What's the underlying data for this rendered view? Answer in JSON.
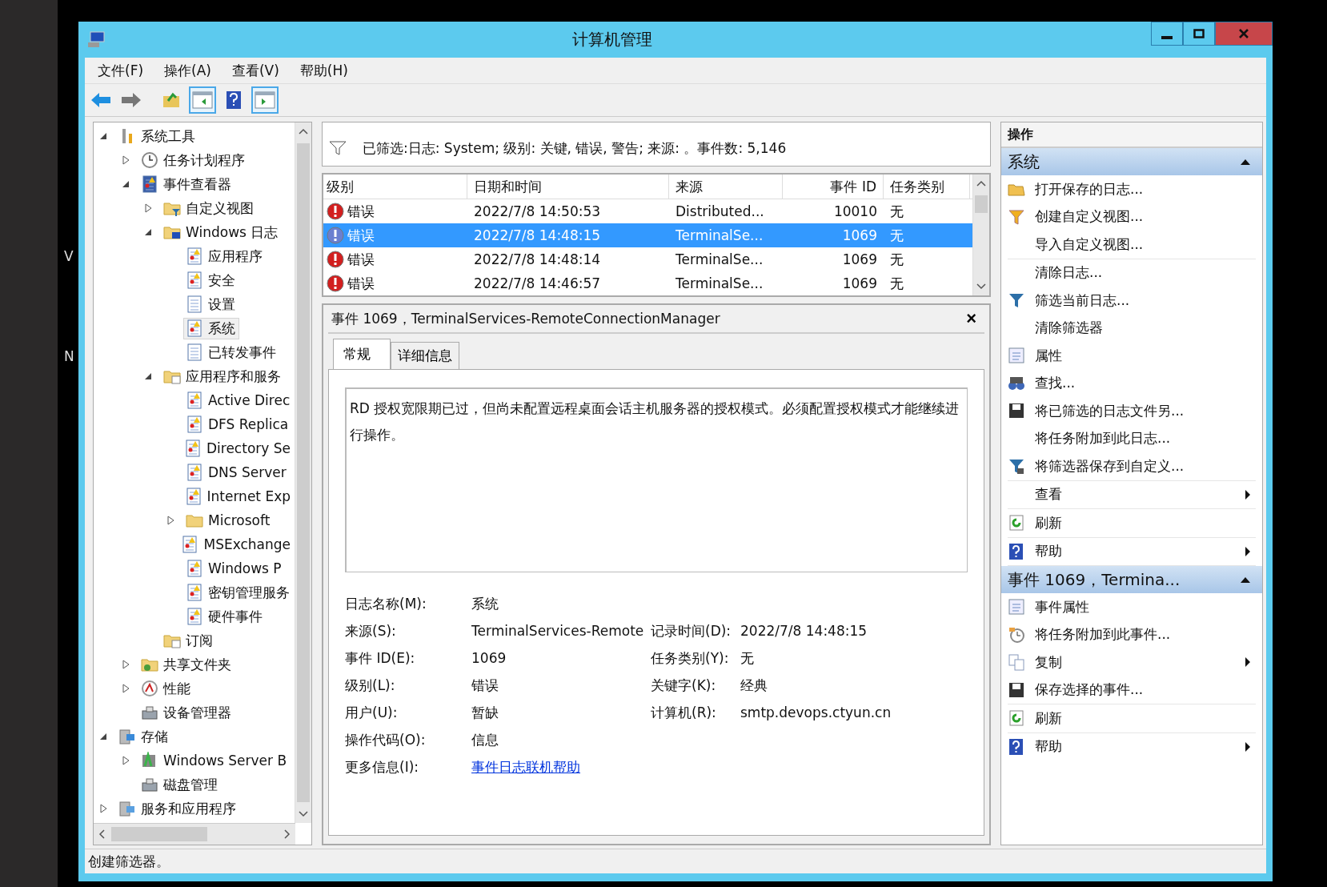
{
  "desktop_fragments": [
    "V",
    "N"
  ],
  "window": {
    "title": "计算机管理"
  },
  "menu": [
    "文件(F)",
    "操作(A)",
    "查看(V)",
    "帮助(H)"
  ],
  "toolbar": [
    {
      "kind": "back",
      "pressed": false
    },
    {
      "kind": "forward",
      "pressed": false
    },
    {
      "kind": "up",
      "pressed": false
    },
    {
      "kind": "tree-toggle",
      "pressed": true
    },
    {
      "kind": "help",
      "pressed": false
    },
    {
      "kind": "action-toggle",
      "pressed": true
    }
  ],
  "tree": {
    "items": [
      {
        "label": "系统工具",
        "kind": "tool",
        "expanded": true,
        "selected": false,
        "children": [
          {
            "label": "任务计划程序",
            "kind": "clock",
            "expanded": false,
            "selected": false
          },
          {
            "label": "事件查看器",
            "kind": "viewer",
            "expanded": true,
            "selected": false,
            "children": [
              {
                "label": "自定义视图",
                "kind": "folder-filter",
                "expanded": false,
                "selected": false
              },
              {
                "label": "Windows 日志",
                "kind": "folder-pc",
                "expanded": true,
                "selected": false,
                "children": [
                  {
                    "label": "应用程序",
                    "kind": "log",
                    "selected": false
                  },
                  {
                    "label": "安全",
                    "kind": "log",
                    "selected": false
                  },
                  {
                    "label": "设置",
                    "kind": "log-plain",
                    "selected": false
                  },
                  {
                    "label": "系统",
                    "kind": "log",
                    "selected": true
                  },
                  {
                    "label": "已转发事件",
                    "kind": "log-plain",
                    "selected": false
                  }
                ]
              },
              {
                "label": "应用程序和服务",
                "kind": "folder-page",
                "expanded": true,
                "selected": false,
                "children": [
                  {
                    "label": "Active Direc",
                    "kind": "log",
                    "selected": false
                  },
                  {
                    "label": "DFS Replica",
                    "kind": "log",
                    "selected": false
                  },
                  {
                    "label": "Directory Se",
                    "kind": "log",
                    "selected": false
                  },
                  {
                    "label": "DNS Server",
                    "kind": "log",
                    "selected": false
                  },
                  {
                    "label": "Internet Exp",
                    "kind": "log",
                    "selected": false
                  },
                  {
                    "label": "Microsoft",
                    "kind": "folder",
                    "expanded": false,
                    "selected": false
                  },
                  {
                    "label": "MSExchange",
                    "kind": "log",
                    "selected": false
                  },
                  {
                    "label": "Windows P",
                    "kind": "log",
                    "selected": false
                  },
                  {
                    "label": "密钥管理服务",
                    "kind": "log",
                    "selected": false
                  },
                  {
                    "label": "硬件事件",
                    "kind": "log",
                    "selected": false
                  }
                ]
              },
              {
                "label": "订阅",
                "kind": "folder-sub",
                "selected": false
              }
            ]
          },
          {
            "label": "共享文件夹",
            "kind": "share",
            "expanded": false,
            "selected": false
          },
          {
            "label": "性能",
            "kind": "perf",
            "expanded": false,
            "selected": false
          },
          {
            "label": "设备管理器",
            "kind": "device",
            "selected": false
          }
        ]
      },
      {
        "label": "存储",
        "kind": "storage",
        "expanded": true,
        "selected": false,
        "children": [
          {
            "label": "Windows Server B",
            "kind": "backup",
            "expanded": false,
            "selected": false
          },
          {
            "label": "磁盘管理",
            "kind": "disk",
            "selected": false
          }
        ]
      },
      {
        "label": "服务和应用程序",
        "kind": "services",
        "expanded": false,
        "selected": false
      }
    ]
  },
  "filter_bar": {
    "text": "已筛选:日志: System; 级别: 关键, 错误, 警告; 来源: 。事件数: 5,146"
  },
  "events": {
    "columns": [
      "级别",
      "日期和时间",
      "来源",
      "事件 ID",
      "任务类别"
    ],
    "rows": [
      {
        "level": "错误",
        "datetime": "2022/7/8 14:50:53",
        "source": "Distributed...",
        "event_id": "10010",
        "task_category": "无",
        "selected": false
      },
      {
        "level": "错误",
        "datetime": "2022/7/8 14:48:15",
        "source": "TerminalSe...",
        "event_id": "1069",
        "task_category": "无",
        "selected": true
      },
      {
        "level": "错误",
        "datetime": "2022/7/8 14:48:14",
        "source": "TerminalSe...",
        "event_id": "1069",
        "task_category": "无",
        "selected": false
      },
      {
        "level": "错误",
        "datetime": "2022/7/8 14:46:57",
        "source": "TerminalSe...",
        "event_id": "1069",
        "task_category": "无",
        "selected": false
      }
    ]
  },
  "detail": {
    "title": "事件 1069，TerminalServices-RemoteConnectionManager",
    "close": "×",
    "tabs": [
      {
        "label": "常规",
        "selected": true
      },
      {
        "label": "详细信息",
        "selected": false
      }
    ],
    "description": "RD 授权宽限期已过，但尚未配置远程桌面会话主机服务器的授权模式。必须配置授权模式才能继续进行操作。",
    "fields": [
      [
        {
          "label": "日志名称(M):",
          "value": "系统",
          "kind": "text"
        }
      ],
      [
        {
          "label": "来源(S):",
          "value": "TerminalServices-Remote",
          "kind": "text"
        },
        {
          "label": "记录时间(D):",
          "value": "2022/7/8 14:48:15",
          "kind": "text"
        }
      ],
      [
        {
          "label": "事件 ID(E):",
          "value": "1069",
          "kind": "text"
        },
        {
          "label": "任务类别(Y):",
          "value": "无",
          "kind": "text"
        }
      ],
      [
        {
          "label": "级别(L):",
          "value": "错误",
          "kind": "text"
        },
        {
          "label": "关键字(K):",
          "value": "经典",
          "kind": "text"
        }
      ],
      [
        {
          "label": "用户(U):",
          "value": "暂缺",
          "kind": "text"
        },
        {
          "label": "计算机(R):",
          "value": "smtp.devops.ctyun.cn",
          "kind": "text"
        }
      ],
      [
        {
          "label": "操作代码(O):",
          "value": "信息",
          "kind": "text"
        }
      ],
      [
        {
          "label": "更多信息(I):",
          "value": "事件日志联机帮助",
          "kind": "link"
        }
      ]
    ]
  },
  "actions": {
    "title": "操作",
    "sections": [
      {
        "title": "系统",
        "expanded": true,
        "groups": [
          [
            {
              "label": "打开保存的日志...",
              "kind": "open",
              "submenu": false
            },
            {
              "label": "创建自定义视图...",
              "kind": "filter",
              "submenu": false
            },
            {
              "label": "导入自定义视图...",
              "kind": "plain",
              "submenu": false
            }
          ],
          [
            {
              "label": "清除日志...",
              "kind": "plain",
              "submenu": false
            },
            {
              "label": "筛选当前日志...",
              "kind": "filter-blue",
              "submenu": false
            },
            {
              "label": "清除筛选器",
              "kind": "plain",
              "submenu": false
            },
            {
              "label": "属性",
              "kind": "props",
              "submenu": false
            },
            {
              "label": "查找...",
              "kind": "find",
              "submenu": false
            },
            {
              "label": "将已筛选的日志文件另...",
              "kind": "save",
              "submenu": false
            },
            {
              "label": "将任务附加到此日志...",
              "kind": "plain",
              "submenu": false
            },
            {
              "label": "将筛选器保存到自定义...",
              "kind": "filter-save",
              "submenu": false
            }
          ],
          [
            {
              "label": "查看",
              "kind": "plain",
              "submenu": true
            }
          ],
          [
            {
              "label": "刷新",
              "kind": "refresh",
              "submenu": false
            }
          ],
          [
            {
              "label": "帮助",
              "kind": "help",
              "submenu": true
            }
          ]
        ]
      },
      {
        "title": "事件 1069，Termina...",
        "expanded": true,
        "groups": [
          [
            {
              "label": "事件属性",
              "kind": "props",
              "submenu": false
            },
            {
              "label": "将任务附加到此事件...",
              "kind": "task",
              "submenu": false
            },
            {
              "label": "复制",
              "kind": "copy",
              "submenu": true
            },
            {
              "label": "保存选择的事件...",
              "kind": "save",
              "submenu": false
            }
          ],
          [
            {
              "label": "刷新",
              "kind": "refresh",
              "submenu": false
            }
          ],
          [
            {
              "label": "帮助",
              "kind": "help",
              "submenu": true
            }
          ]
        ]
      }
    ]
  },
  "status_bar": {
    "text": "创建筛选器。"
  }
}
